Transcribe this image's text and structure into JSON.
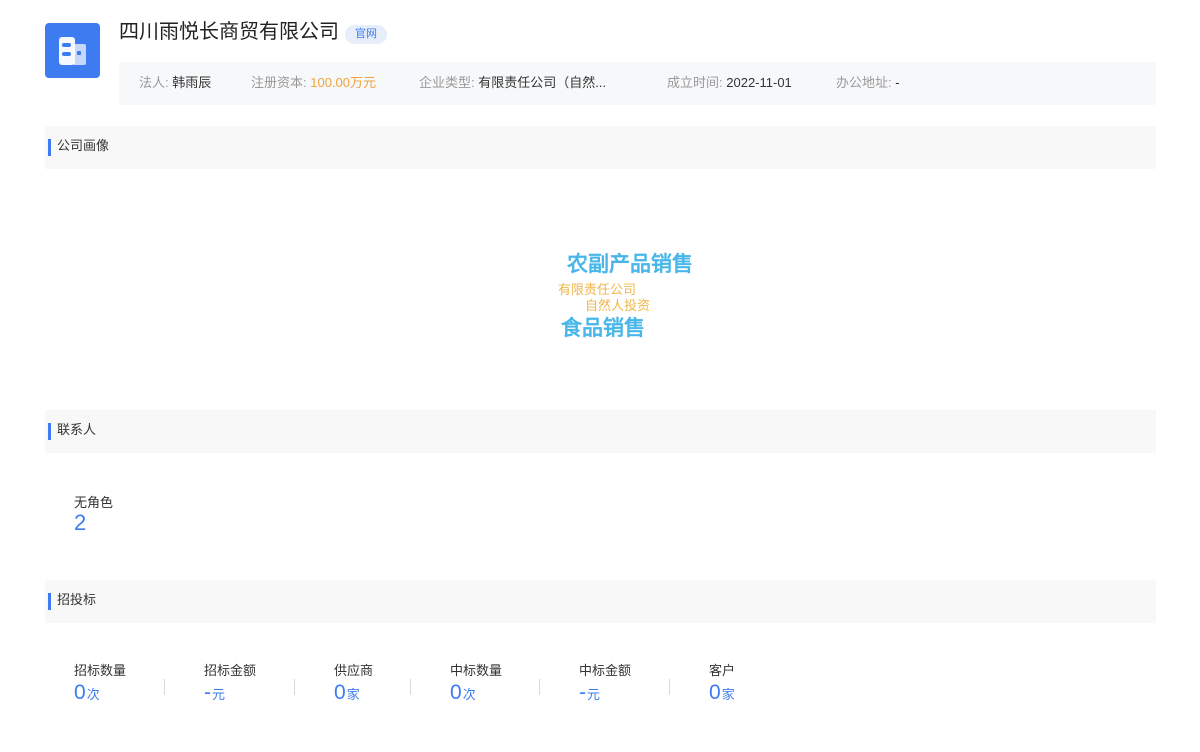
{
  "company": {
    "name": "四川雨悦长商贸有限公司",
    "official_tag": "官网",
    "logo_icon": "building-icon",
    "brand_color": "#3d7cf0"
  },
  "info": {
    "legal_person_label": "法人:",
    "legal_person": "韩雨辰",
    "capital_label": "注册资本:",
    "capital": "100.00万元",
    "type_label": "企业类型:",
    "type": "有限责任公司（自然...",
    "founded_label": "成立时间:",
    "founded": "2022-11-01",
    "address_label": "办公地址:",
    "address": "-"
  },
  "sections": {
    "portrait": "公司画像",
    "contacts": "联系人",
    "bidding": "招投标"
  },
  "portrait_words": [
    "农副产品销售",
    "有限责任公司",
    "自然人投资",
    "食品销售"
  ],
  "contacts": {
    "label": "无角色",
    "value": "2"
  },
  "bidding_stats": [
    {
      "label": "招标数量",
      "value": "0",
      "unit": "次"
    },
    {
      "label": "招标金额",
      "value": "-",
      "unit": "元"
    },
    {
      "label": "供应商",
      "value": "0",
      "unit": "家"
    },
    {
      "label": "中标数量",
      "value": "0",
      "unit": "次"
    },
    {
      "label": "中标金额",
      "value": "-",
      "unit": "元"
    },
    {
      "label": "客户",
      "value": "0",
      "unit": "家"
    }
  ]
}
